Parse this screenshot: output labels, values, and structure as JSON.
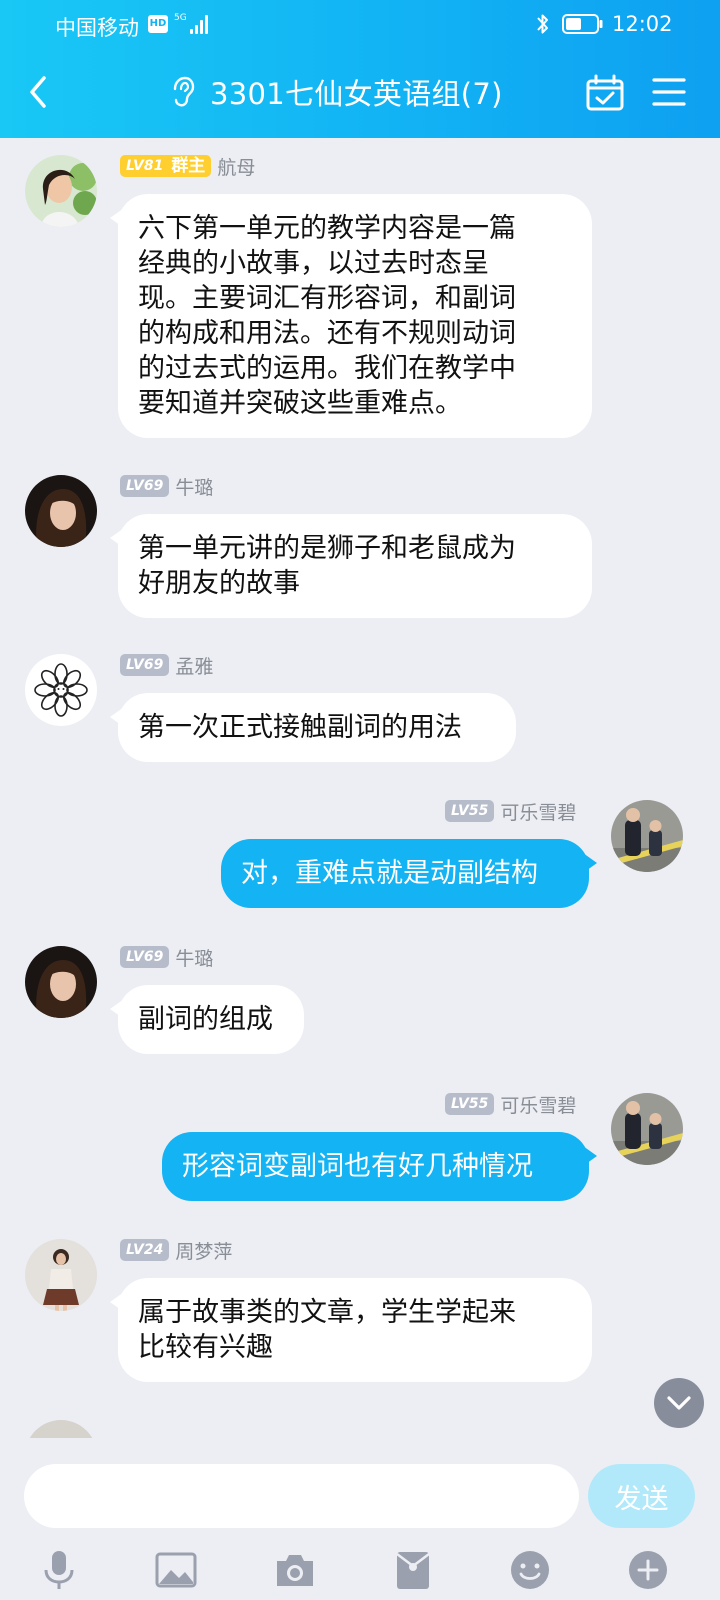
{
  "status_bar": {
    "carrier": "中国移动",
    "hd": "HD",
    "network": "5G",
    "time": "12:02"
  },
  "header": {
    "title": "3301七仙女英语组(7)"
  },
  "messages": [
    {
      "side": "left",
      "level": "LV81",
      "role": "群主",
      "name": "航母",
      "lines": [
        "六下第一单元的教学内容是一篇",
        "经典的小故事，以过去时态呈",
        "现。主要词汇有形容词，和副词",
        "的构成和用法。还有不规则动词",
        "的过去式的运用。我们在教学中",
        "要知道并突破这些重难点。"
      ]
    },
    {
      "side": "left",
      "level": "LV69",
      "name": "牛璐",
      "lines": [
        "第一单元讲的是狮子和老鼠成为",
        "好朋友的故事"
      ]
    },
    {
      "side": "left",
      "level": "LV69",
      "name": "孟雅",
      "lines": [
        "第一次正式接触副词的用法"
      ]
    },
    {
      "side": "right",
      "level": "LV55",
      "name": "可乐雪碧",
      "lines": [
        "对，重难点就是动副结构"
      ]
    },
    {
      "side": "left",
      "level": "LV69",
      "name": "牛璐",
      "lines": [
        "副词的组成"
      ]
    },
    {
      "side": "right",
      "level": "LV55",
      "name": "可乐雪碧",
      "lines": [
        "形容词变副词也有好几种情况"
      ]
    },
    {
      "side": "left",
      "level": "LV24",
      "name": "周梦萍",
      "lines": [
        "属于故事类的文章，学生学起来",
        "比较有兴趣"
      ]
    }
  ],
  "composer": {
    "input_value": "",
    "send_label": "发送"
  },
  "toolbar_icons": [
    "microphone-icon",
    "image-icon",
    "camera-icon",
    "red-packet-icon",
    "emoji-icon",
    "plus-icon"
  ],
  "colors": {
    "header_gradient_start": "#19c8f5",
    "header_gradient_end": "#0ea0f1",
    "outgoing_bubble": "#13b3f4",
    "incoming_bubble": "#ffffff",
    "background": "#eceef3",
    "owner_badge": "#ffce2f",
    "level_badge": "#b6bcca",
    "send_button": "#b1e9fb",
    "toolbar_icon": "#9aa0ad"
  }
}
